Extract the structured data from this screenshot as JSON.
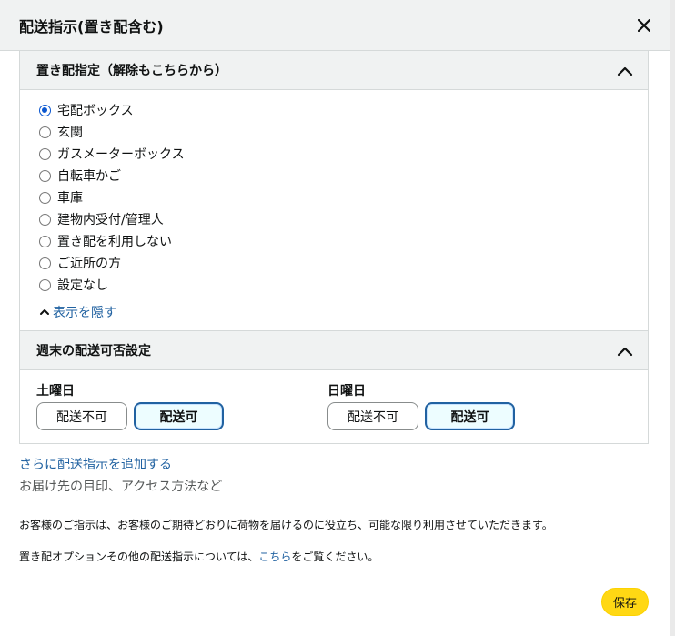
{
  "dialog": {
    "title": "配送指示(置き配含む)",
    "close_icon": "close-icon"
  },
  "unattended": {
    "title": "置き配指定（解除もこちらから）",
    "options": [
      {
        "label": "宅配ボックス",
        "selected": true
      },
      {
        "label": "玄関",
        "selected": false
      },
      {
        "label": "ガスメーターボックス",
        "selected": false
      },
      {
        "label": "自転車かご",
        "selected": false
      },
      {
        "label": "車庫",
        "selected": false
      },
      {
        "label": "建物内受付/管理人",
        "selected": false
      },
      {
        "label": "置き配を利用しない",
        "selected": false
      },
      {
        "label": "ご近所の方",
        "selected": false
      },
      {
        "label": "設定なし",
        "selected": false
      }
    ],
    "hide_label": "表示を隠す"
  },
  "weekend": {
    "title": "週末の配送可否設定",
    "saturday": {
      "label": "土曜日",
      "off_label": "配送不可",
      "on_label": "配送可",
      "selected": "配送可"
    },
    "sunday": {
      "label": "日曜日",
      "off_label": "配送不可",
      "on_label": "配送可",
      "selected": "配送可"
    }
  },
  "more": {
    "add_link": "さらに配送指示を追加する",
    "add_sub": "お届け先の目印、アクセス方法など"
  },
  "notes": {
    "line1": "お客様のご指示は、お客様のご期待どおりに荷物を届けるのに役立ち、可能な限り利用させていただきます。",
    "line2_prefix": "置き配オプションその他の配送指示については、",
    "line2_link": "こちら",
    "line2_suffix": "をご覧ください。"
  },
  "footer": {
    "save_label": "保存"
  },
  "colors": {
    "accent_blue": "#2162a1",
    "save_yellow": "#ffd814",
    "radio_blue": "#0b57d0"
  }
}
